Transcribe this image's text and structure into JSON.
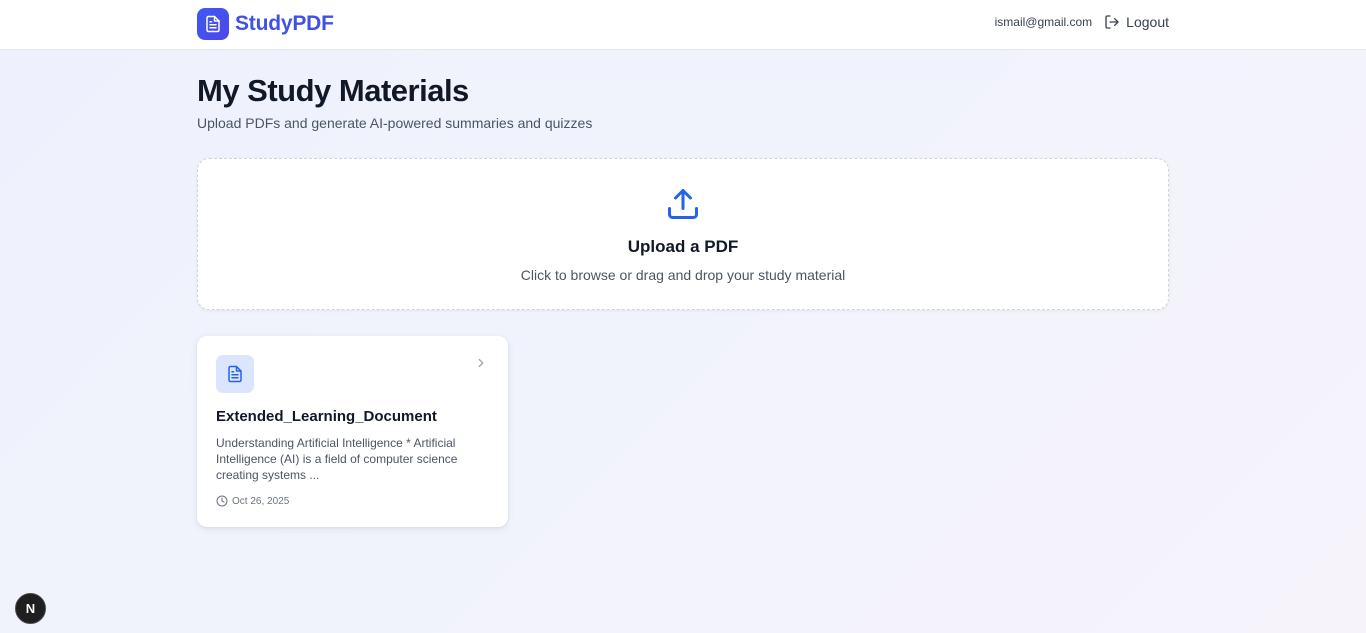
{
  "header": {
    "brand_name": "StudyPDF",
    "user_email": "ismail@gmail.com",
    "logout_label": "Logout"
  },
  "main": {
    "title": "My Study Materials",
    "subtitle": "Upload PDFs and generate AI-powered summaries and quizzes"
  },
  "upload": {
    "title": "Upload a PDF",
    "hint": "Click to browse or drag and drop your study material"
  },
  "documents": [
    {
      "title": "Extended_Learning_Document",
      "excerpt": "Understanding Artificial Intelligence * Artificial Intelligence (AI) is a field of computer science creating systems ...",
      "date": "Oct 26, 2025"
    }
  ],
  "dev_badge": {
    "label": "N"
  },
  "colors": {
    "brand": "#4051e6",
    "accent_blue": "#2563eb",
    "icon_bg": "#dbe5fe"
  },
  "icons": {
    "logo": "document-icon",
    "logout": "logout-icon",
    "upload": "upload-icon",
    "doc": "file-text-icon",
    "chevron": "chevron-right-icon",
    "date": "clock-icon"
  }
}
